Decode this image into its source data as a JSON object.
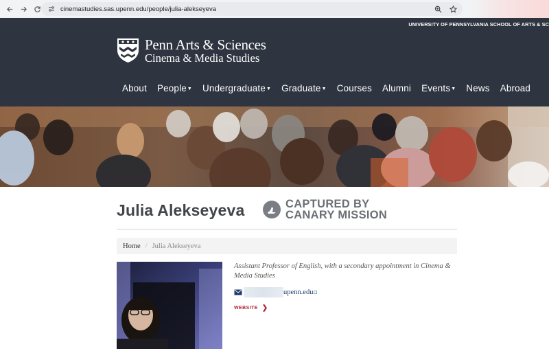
{
  "browser": {
    "url": "cinemastudies.sas.upenn.edu/people/julia-alekseyeva",
    "icons": [
      "back-arrow-icon",
      "forward-arrow-icon",
      "reload-icon",
      "site-settings-icon",
      "zoom-icon",
      "bookmark-star-icon"
    ]
  },
  "header": {
    "university_link": "UNIVERSITY OF PENNSYLVANIA SCHOOL OF ARTS & SC",
    "logo_line1": "Penn Arts & Sciences",
    "logo_line2": "Cinema & Media Studies",
    "nav": [
      {
        "label": "About",
        "dropdown": false
      },
      {
        "label": "People",
        "dropdown": true
      },
      {
        "label": "Undergraduate",
        "dropdown": true
      },
      {
        "label": "Graduate",
        "dropdown": true
      },
      {
        "label": "Courses",
        "dropdown": false
      },
      {
        "label": "Alumni",
        "dropdown": false
      },
      {
        "label": "Events",
        "dropdown": true
      },
      {
        "label": "News",
        "dropdown": false
      },
      {
        "label": "Abroad",
        "dropdown": false
      }
    ]
  },
  "colors": {
    "header_bg": "#2f3540",
    "title": "#414449",
    "link_red": "#b3263b",
    "stamp_gray": "#6b6f75"
  },
  "profile": {
    "name": "Julia Alekseyeva",
    "stamp_line1": "CAPTURED BY",
    "stamp_line2": "CANARY MISSION",
    "breadcrumb_home": "Home",
    "breadcrumb_current": "Julia Alekseyeva",
    "position": "Assistant Professor of English, with a secondary appointment in Cinema & Media Studies",
    "email_domain": "upenn.edu",
    "website_label": "WEBSITE"
  }
}
